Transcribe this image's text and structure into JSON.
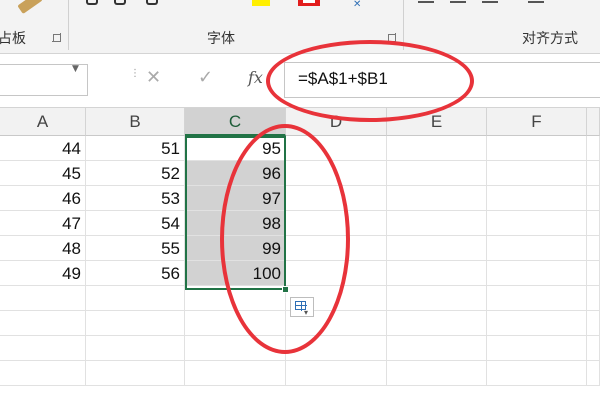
{
  "ribbon": {
    "groups": [
      {
        "label": "占板"
      },
      {
        "label": "字体"
      },
      {
        "label": "对齐方式"
      }
    ]
  },
  "formula_bar": {
    "name_box_value": "",
    "cancel_glyph": "✕",
    "enter_glyph": "✓",
    "fx_label": "fx",
    "formula": "=$A$1+$B1"
  },
  "grid": {
    "columns": [
      "A",
      "B",
      "C",
      "D",
      "E",
      "F"
    ],
    "selected_column": "C",
    "rows": [
      {
        "a": "44",
        "b": "51",
        "c": "95"
      },
      {
        "a": "45",
        "b": "52",
        "c": "96"
      },
      {
        "a": "46",
        "b": "53",
        "c": "97"
      },
      {
        "a": "47",
        "b": "54",
        "c": "98"
      },
      {
        "a": "48",
        "b": "55",
        "c": "99"
      },
      {
        "a": "49",
        "b": "56",
        "c": "100"
      }
    ]
  },
  "colors": {
    "selection_green": "#217346",
    "annotation_red": "#e8333a",
    "highlight_yellow": "#ffef00",
    "font_red": "#e21d1d"
  }
}
